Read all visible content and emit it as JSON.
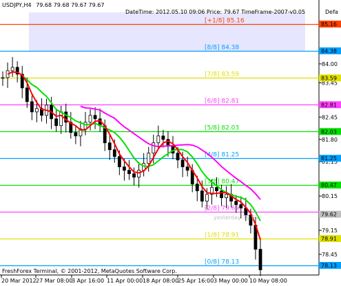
{
  "header": {
    "symbol": "USDJPY,H4",
    "ohlc": "79.68 79.68 79.67 79.67",
    "info": "DateTime: 2012.05.10 09:06   Price: 79.67   TimeFrame-2007-v0.05",
    "info_truncated": "Defa"
  },
  "footer": {
    "copyright": "FreshForex Terminal, © 2001-2012, MetaQuotes Software Corp."
  },
  "chart_data": {
    "type": "candlestick",
    "y_axis": {
      "ticks": [
        84.0,
        83.45,
        82.45,
        81.8,
        81.15,
        80.15,
        79.15,
        78.45
      ],
      "tick_labels": [
        "84.00",
        "83.45",
        "82.45",
        "81.80",
        "81.15",
        "80.15",
        "79.15",
        "78.45"
      ],
      "ylim": [
        78.0,
        86.0
      ]
    },
    "x_axis": {
      "tick_labels": [
        "20 Mar 2012",
        "27 Mar 08:00",
        "3 Apr 16:00",
        "11 Apr 00:00",
        "18 Apr 08:00",
        "25 Apr 16:00",
        "3 May 00:00",
        "10 May 08:00"
      ]
    },
    "murrey_levels": [
      {
        "label": "[+1/8]",
        "value": "85.16",
        "color": "#ff4000"
      },
      {
        "label": "[8/8]",
        "value": "84.38",
        "color": "#00a0ff"
      },
      {
        "label": "[7/8]",
        "value": "83.59",
        "color": "#e0e000"
      },
      {
        "label": "[6/8]",
        "value": "82.81",
        "color": "#ff40ff"
      },
      {
        "label": "[5/8]",
        "value": "82.03",
        "color": "#00e000"
      },
      {
        "label": "[4/8]",
        "value": "81.25",
        "color": "#00a0ff"
      },
      {
        "label": "[3/8]",
        "value": "80.47",
        "color": "#00e000"
      },
      {
        "label": "[2/8]",
        "value": "79.69",
        "color": "#ff40ff"
      },
      {
        "label": "[1/8]",
        "value": "78.91",
        "color": "#e0e000"
      },
      {
        "label": "[0/8]",
        "value": "78.13",
        "color": "#00a0ff"
      }
    ],
    "right_price_badges": [
      {
        "value": "85.16",
        "color": "#ff4000"
      },
      {
        "value": "84.38",
        "color": "#00a0ff"
      },
      {
        "value": "83.59",
        "color": "#e0e000"
      },
      {
        "value": "82.81",
        "color": "#ff40ff"
      },
      {
        "value": "82.03",
        "color": "#00e000"
      },
      {
        "value": "81.25",
        "color": "#00a0ff"
      },
      {
        "value": "80.47",
        "color": "#00e000"
      },
      {
        "value": "79.62",
        "color": "#c0c0c0"
      },
      {
        "value": "78.91",
        "color": "#e0e000"
      },
      {
        "value": "78.13",
        "color": "#00a0ff"
      }
    ],
    "bid_label": "yesterday 79.62",
    "bid_right_value": "79.62",
    "close_series": [
      83.6,
      83.8,
      83.9,
      83.7,
      83.3,
      82.9,
      82.6,
      82.7,
      82.5,
      82.8,
      82.4,
      82.2,
      82.6,
      82.3,
      82.0,
      81.9,
      82.1,
      82.3,
      82.5,
      82.4,
      82.2,
      81.7,
      81.5,
      81.3,
      81.0,
      80.9,
      80.8,
      80.7,
      80.9,
      81.1,
      81.4,
      81.7,
      81.9,
      81.8,
      81.6,
      81.4,
      81.2,
      81.0,
      80.9,
      80.5,
      80.3,
      80.0,
      80.2,
      80.4,
      80.3,
      80.1,
      80.2,
      80.0,
      79.9,
      79.8,
      79.6,
      79.3,
      78.6,
      78.0
    ]
  }
}
